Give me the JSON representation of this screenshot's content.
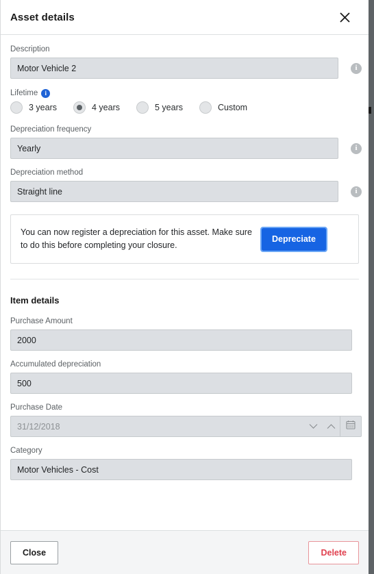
{
  "dialog": {
    "title": "Asset details",
    "close_icon": "close-icon"
  },
  "form": {
    "description": {
      "label": "Description",
      "value": "Motor Vehicle 2",
      "info_icon": "info-icon"
    },
    "lifetime": {
      "label": "Lifetime",
      "info_icon": "info-icon",
      "options": [
        {
          "label": "3 years",
          "selected": false
        },
        {
          "label": "4 years",
          "selected": true
        },
        {
          "label": "5 years",
          "selected": false
        },
        {
          "label": "Custom",
          "selected": false
        }
      ]
    },
    "depreciation_frequency": {
      "label": "Depreciation frequency",
      "value": "Yearly",
      "info_icon": "info-icon"
    },
    "depreciation_method": {
      "label": "Depreciation method",
      "value": "Straight line",
      "info_icon": "info-icon"
    }
  },
  "alert": {
    "message": "You can now register a depreciation for this asset. Make sure to do this before completing your closure.",
    "button_label": "Depreciate",
    "button_color": "#1664e3",
    "focus_ring_color": "#6aa6f5"
  },
  "item_details": {
    "section_title": "Item details",
    "purchase_amount": {
      "label": "Purchase Amount",
      "value": "2000"
    },
    "accumulated_depreciation": {
      "label": "Accumulated depreciation",
      "value": "500"
    },
    "purchase_date": {
      "label": "Purchase Date",
      "value": "31/12/2018",
      "spin_down_icon": "chevron-down-icon",
      "spin_up_icon": "chevron-up-icon",
      "calendar_icon": "calendar-icon"
    },
    "category": {
      "label": "Category",
      "value": "Motor Vehicles - Cost"
    }
  },
  "footer": {
    "close_label": "Close",
    "delete_label": "Delete",
    "delete_color": "#e0414f"
  }
}
